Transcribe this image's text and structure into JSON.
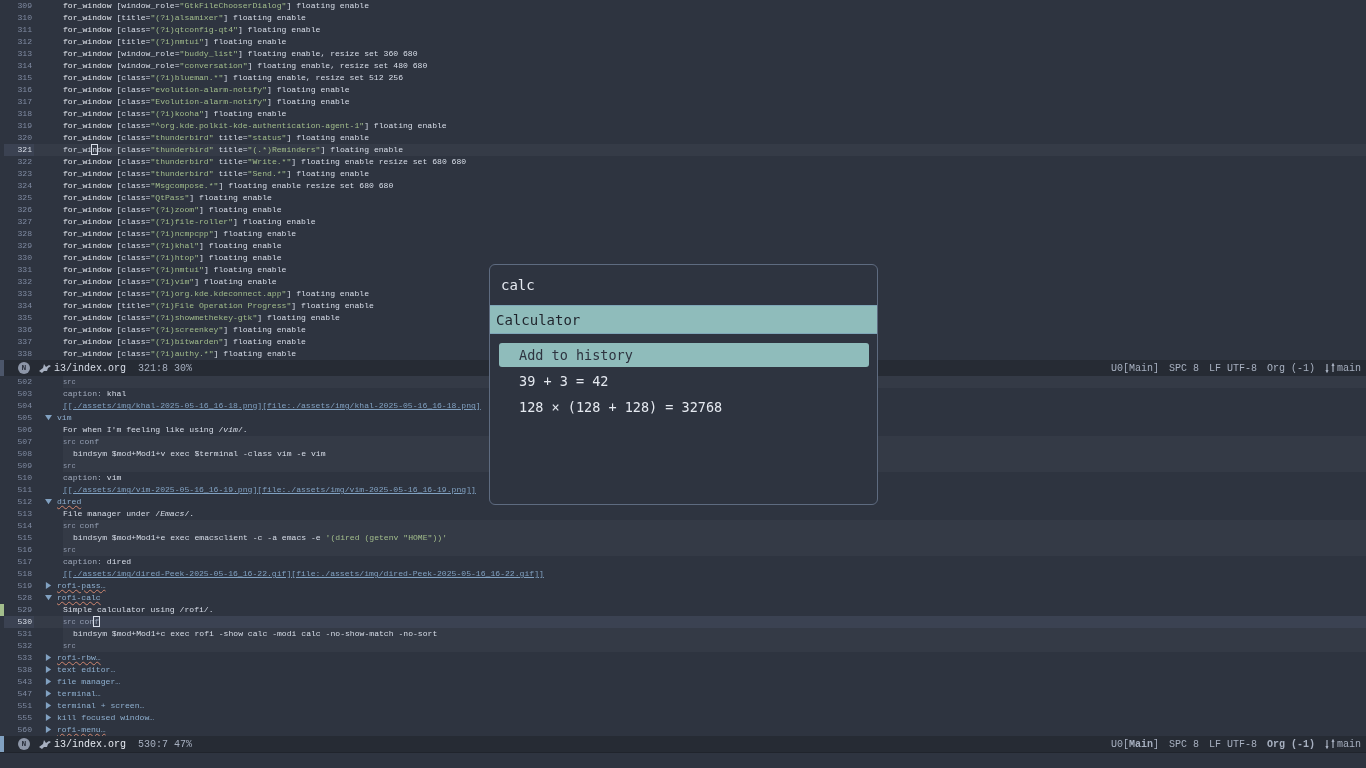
{
  "top_pane": {
    "lines": [
      {
        "number": "309",
        "current": false,
        "text": "for_window [window_role=\"GtkFileChooserDialog\"] floating enable"
      },
      {
        "number": "310",
        "current": false,
        "text": "for_window [title=\"(?i)alsamixer\"] floating enable"
      },
      {
        "number": "311",
        "current": false,
        "text": "for_window [class=\"(?i)qtconfig-qt4\"] floating enable"
      },
      {
        "number": "312",
        "current": false,
        "text": "for_window [title=\"(?i)nmtui\"] floating enable"
      },
      {
        "number": "313",
        "current": false,
        "text": "for_window [window_role=\"buddy_list\"] floating enable, resize set 360 680"
      },
      {
        "number": "314",
        "current": false,
        "text": "for_window [window_role=\"conversation\"] floating enable, resize set 480 680"
      },
      {
        "number": "315",
        "current": false,
        "text": "for_window [class=\"(?i)blueman.*\"] floating enable, resize set 512 256"
      },
      {
        "number": "316",
        "current": false,
        "text": "for_window [class=\"evolution-alarm-notify\"] floating enable"
      },
      {
        "number": "317",
        "current": false,
        "text": "for_window [class=\"Evolution-alarm-notify\"] floating enable"
      },
      {
        "number": "318",
        "current": false,
        "text": "for_window [class=\"(?i)kooha\"] floating enable"
      },
      {
        "number": "319",
        "current": false,
        "text": "for_window [class=\"^org.kde.polkit-kde-authentication-agent-1\"] floating enable"
      },
      {
        "number": "320",
        "current": false,
        "text": "for_window [class=\"thunderbird\" title=\"status\"] floating enable"
      },
      {
        "number": "321",
        "current": true,
        "text": {
          "before": "for_wi",
          "at": "n",
          "after": "dow [class=\"thunderbird\" title=\"(.*)Reminders\"] floating enable"
        }
      },
      {
        "number": "322",
        "current": false,
        "text": "for_window [class=\"thunderbird\" title=\"Write.*\"] floating enable resize set 680 680"
      },
      {
        "number": "323",
        "current": false,
        "text": "for_window [class=\"thunderbird\" title=\"Send.*\"] floating enable"
      },
      {
        "number": "324",
        "current": false,
        "text": "for_window [class=\"Msgcompose.*\"] floating enable resize set 680 680"
      },
      {
        "number": "325",
        "current": false,
        "text": "for_window [class=\"QtPass\"] floating enable"
      },
      {
        "number": "326",
        "current": false,
        "text": "for_window [class=\"(?i)zoom\"] floating enable"
      },
      {
        "number": "327",
        "current": false,
        "text": "for_window [class=\"(?i)file-roller\"] floating enable"
      },
      {
        "number": "328",
        "current": false,
        "text": "for_window [class=\"(?i)ncmpcpp\"] floating enable"
      },
      {
        "number": "329",
        "current": false,
        "text": "for_window [class=\"(?i)khal\"] floating enable"
      },
      {
        "number": "330",
        "current": false,
        "text": "for_window [class=\"(?i)htop\"] floating enable"
      },
      {
        "number": "331",
        "current": false,
        "text": "for_window [class=\"(?i)nmtui\"] floating enable"
      },
      {
        "number": "332",
        "current": false,
        "text": "for_window [class=\"(?i)vim\"] floating enable"
      },
      {
        "number": "333",
        "current": false,
        "text": "for_window [class=\"(?i)org.kde.kdeconnect.app\"] floating enable"
      },
      {
        "number": "334",
        "current": false,
        "text": "for_window [title=\"(?i)File Operation Progress\"] floating enable"
      },
      {
        "number": "335",
        "current": false,
        "text": "for_window [class=\"(?i)showmethekey-gtk\"] floating enable"
      },
      {
        "number": "336",
        "current": false,
        "text": "for_window [class=\"(?i)screenkey\"] floating enable"
      },
      {
        "number": "337",
        "current": false,
        "text": "for_window [class=\"(?i)bitwarden\"] floating enable"
      },
      {
        "number": "338",
        "current": false,
        "text": "for_window [class=\"(?i)authy.*\"] floating enable"
      }
    ],
    "modeline": {
      "active": false,
      "state": "N",
      "file": "i3/index.org",
      "position": "321:8",
      "percent": "30%",
      "segments": [
        {
          "kind": "input_method",
          "text": "U0[Main]"
        },
        {
          "kind": "indent",
          "text": "SPC 8"
        },
        {
          "kind": "encoding",
          "text": "LF UTF-8"
        },
        {
          "kind": "major_mode",
          "text": "Org (-1)"
        },
        {
          "kind": "vcs",
          "text": "main"
        }
      ]
    }
  },
  "bottom_pane": {
    "lines": [
      {
        "number": "502",
        "current": false,
        "kind": "src_end",
        "marker": "src"
      },
      {
        "number": "503",
        "current": false,
        "kind": "caption",
        "key": "caption:",
        "value": "khal"
      },
      {
        "number": "504",
        "current": false,
        "kind": "link",
        "text": "[[./assets/img/khal-2025-05-16_16-18.png][file:./assets/img/khal-2025-05-16_16-18.png]"
      },
      {
        "number": "505",
        "current": false,
        "kind": "heading",
        "text": "vim",
        "expanded": true,
        "misspelled": false
      },
      {
        "number": "506",
        "current": false,
        "kind": "body",
        "text": "For when I'm feeling like using /*vim*/."
      },
      {
        "number": "507",
        "current": false,
        "kind": "src_begin",
        "marker": "src",
        "lang": "conf"
      },
      {
        "number": "508",
        "current": false,
        "kind": "code",
        "text": "bindsym $mod+Mod1+v exec $terminal -class vim -e vim"
      },
      {
        "number": "509",
        "current": false,
        "kind": "src_end",
        "marker": "src"
      },
      {
        "number": "510",
        "current": false,
        "kind": "caption",
        "key": "caption:",
        "value": "vim"
      },
      {
        "number": "511",
        "current": false,
        "kind": "link",
        "text": "[[./assets/img/vim-2025-05-16_16-19.png][file:./assets/img/vim-2025-05-16_16-19.png]]"
      },
      {
        "number": "512",
        "current": false,
        "kind": "heading",
        "text": "dired",
        "expanded": true,
        "misspelled": true
      },
      {
        "number": "513",
        "current": false,
        "kind": "body",
        "text": "File manager under /*Emacs*/."
      },
      {
        "number": "514",
        "current": false,
        "kind": "src_begin",
        "marker": "src",
        "lang": "conf"
      },
      {
        "number": "515",
        "current": false,
        "kind": "code",
        "text": "bindsym $mod+Mod1+e exec emacsclient -c -a emacs -e '(dired (getenv \"HOME\"))'"
      },
      {
        "number": "516",
        "current": false,
        "kind": "src_end",
        "marker": "src"
      },
      {
        "number": "517",
        "current": false,
        "kind": "caption",
        "key": "caption:",
        "value": "dired"
      },
      {
        "number": "518",
        "current": false,
        "kind": "link",
        "text": "[[./assets/img/dired-Peek-2025-05-16_16-22.gif][file:./assets/img/dired-Peek-2025-05-16_16-22.gif]]"
      },
      {
        "number": "519",
        "current": false,
        "kind": "heading",
        "text": "rofi-pass…",
        "expanded": false,
        "misspelled": true
      },
      {
        "number": "528",
        "current": false,
        "kind": "heading",
        "text": "rofi-calc",
        "expanded": true,
        "misspelled": true
      },
      {
        "number": "529",
        "current": false,
        "kind": "body",
        "text": "Simple calculator using /rofi/.",
        "vc_added": true
      },
      {
        "number": "530",
        "current": true,
        "kind": "src_begin",
        "marker": "src",
        "lang": {
          "before": "con",
          "at": "f"
        }
      },
      {
        "number": "531",
        "current": false,
        "kind": "code",
        "text": "bindsym $mod+Mod1+c exec rofi -show calc -modi calc -no-show-match -no-sort"
      },
      {
        "number": "532",
        "current": false,
        "kind": "src_end",
        "marker": "src"
      },
      {
        "number": "533",
        "current": false,
        "kind": "heading",
        "text": "rofi-rbw…",
        "expanded": false,
        "misspelled": true
      },
      {
        "number": "538",
        "current": false,
        "kind": "heading",
        "text": "text editor…",
        "expanded": false,
        "misspelled": false
      },
      {
        "number": "543",
        "current": false,
        "kind": "heading",
        "text": "file manager…",
        "expanded": false,
        "misspelled": false
      },
      {
        "number": "547",
        "current": false,
        "kind": "heading",
        "text": "terminal…",
        "expanded": false,
        "misspelled": false
      },
      {
        "number": "551",
        "current": false,
        "kind": "heading",
        "text": "terminal + screen…",
        "expanded": false,
        "misspelled": false
      },
      {
        "number": "555",
        "current": false,
        "kind": "heading",
        "text": "kill focused window…",
        "expanded": false,
        "misspelled": false
      },
      {
        "number": "560",
        "current": false,
        "kind": "heading",
        "text": "rofi-menu…",
        "expanded": false,
        "misspelled": true
      }
    ],
    "modeline": {
      "active": true,
      "state": "N",
      "file": "i3/index.org",
      "position": "530:7",
      "percent": "47%",
      "segments": [
        {
          "kind": "input_method",
          "text": "U0[**Main**]"
        },
        {
          "kind": "indent",
          "text": "SPC 8"
        },
        {
          "kind": "encoding",
          "text": "LF UTF-8"
        },
        {
          "kind": "major_mode",
          "text": "Org (-1)"
        },
        {
          "kind": "vcs",
          "text": "main"
        }
      ]
    }
  },
  "launcher": {
    "input": "calc",
    "modes": [
      {
        "label": "Calculator",
        "selected": true
      }
    ],
    "results": [
      {
        "text": "Add to history",
        "selected": true
      },
      {
        "text": "39 + 3 = 42",
        "selected": false
      },
      {
        "text": "128 × (128 + 128) = 32768",
        "selected": false
      }
    ]
  }
}
